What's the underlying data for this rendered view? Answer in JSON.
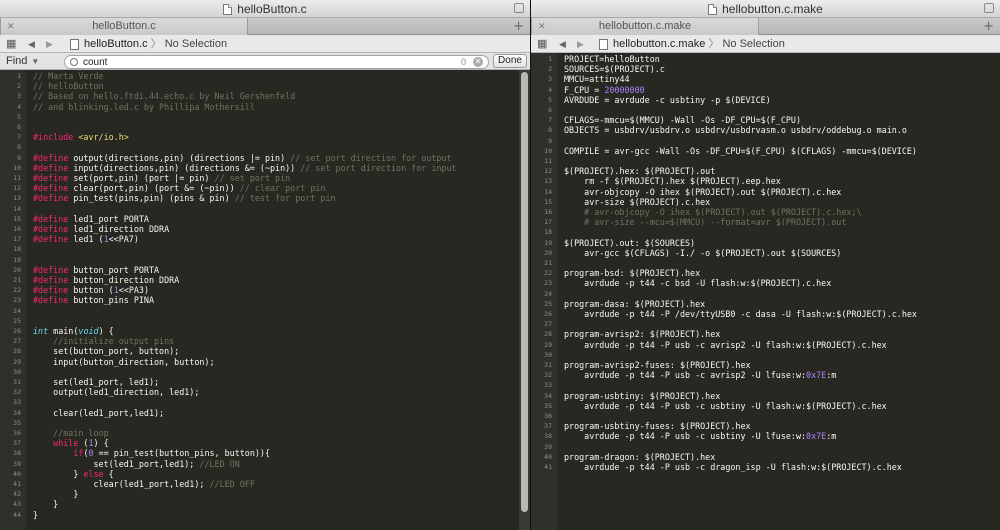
{
  "left": {
    "window_title": "helloButton.c",
    "tab_label": "helloButton.c",
    "jump_file": "helloButton.c",
    "jump_selection": "No Selection",
    "find": {
      "label": "Find",
      "value": "count",
      "match_count": "0",
      "done_label": "Done"
    },
    "lines": [
      "// Marta Verde",
      "// helloButton",
      "// Based on hello.ftdi.44.echo.c by Neil Gershenfeld",
      "// and blinking.led.c by Phillipa Mothersill",
      "",
      "",
      "#include <avr/io.h>",
      "",
      "#define output(directions,pin) (directions |= pin) // set port direction for output",
      "#define input(directions,pin) (directions &= (~pin)) // set port direction for input",
      "#define set(port,pin) (port |= pin) // set port pin",
      "#define clear(port,pin) (port &= (~pin)) // clear port pin",
      "#define pin_test(pins,pin) (pins & pin) // test for port pin",
      "",
      "#define led1_port PORTA",
      "#define led1_direction DDRA",
      "#define led1 (1<<PA7)",
      "",
      "",
      "#define button_port PORTA",
      "#define button_direction DDRA",
      "#define button (1<<PA3)",
      "#define button_pins PINA",
      "",
      "",
      "int main(void) {",
      "    //initialize output pins",
      "    set(button_port, button);",
      "    input(button_direction, button);",
      "",
      "    set(led1_port, led1);",
      "    output(led1_direction, led1);",
      "",
      "    clear(led1_port,led1);",
      "",
      "    //main loop",
      "    while (1) {",
      "        if(0 == pin_test(button_pins, button)){",
      "            set(led1_port,led1); //LED ON",
      "        } else {",
      "            clear(led1_port,led1); //LED OFF",
      "        }",
      "    }",
      "}"
    ]
  },
  "right": {
    "window_title": "hellobutton.c.make",
    "tab_label": "hellobutton.c.make",
    "jump_file": "hellobutton.c.make",
    "jump_selection": "No Selection",
    "lines": [
      "PROJECT=helloButton",
      "SOURCES=$(PROJECT).c",
      "MMCU=attiny44",
      "F_CPU = 20000000",
      "AVRDUDE = avrdude -c usbtiny -p $(DEVICE)",
      "",
      "CFLAGS=-mmcu=$(MMCU) -Wall -Os -DF_CPU=$(F_CPU)",
      "OBJECTS = usbdrv/usbdrv.o usbdrv/usbdrvasm.o usbdrv/oddebug.o main.o",
      "",
      "COMPILE = avr-gcc -Wall -Os -DF_CPU=$(F_CPU) $(CFLAGS) -mmcu=$(DEVICE)",
      "",
      "$(PROJECT).hex: $(PROJECT).out",
      "    rm -f $(PROJECT).hex $(PROJECT).eep.hex",
      "    avr-objcopy -O ihex $(PROJECT).out $(PROJECT).c.hex",
      "    avr-size $(PROJECT).c.hex",
      "    # avr-objcopy -O ihex $(PROJECT).out $(PROJECT).c.hex;\\",
      "    # avr-size --mcu=$(MMCU) --format=avr $(PROJECT).out",
      "",
      "$(PROJECT).out: $(SOURCES)",
      "    avr-gcc $(CFLAGS) -I./ -o $(PROJECT).out $(SOURCES)",
      "",
      "program-bsd: $(PROJECT).hex",
      "    avrdude -p t44 -c bsd -U flash:w:$(PROJECT).c.hex",
      "",
      "program-dasa: $(PROJECT).hex",
      "    avrdude -p t44 -P /dev/ttyUSB0 -c dasa -U flash:w:$(PROJECT).c.hex",
      "",
      "program-avrisp2: $(PROJECT).hex",
      "    avrdude -p t44 -P usb -c avrisp2 -U flash:w:$(PROJECT).c.hex",
      "",
      "program-avrisp2-fuses: $(PROJECT).hex",
      "    avrdude -p t44 -P usb -c avrisp2 -U lfuse:w:0x7E:m",
      "",
      "program-usbtiny: $(PROJECT).hex",
      "    avrdude -p t44 -P usb -c usbtiny -U flash:w:$(PROJECT).c.hex",
      "",
      "program-usbtiny-fuses: $(PROJECT).hex",
      "    avrdude -p t44 -P usb -c usbtiny -U lfuse:w:0x7E:m",
      "",
      "program-dragon: $(PROJECT).hex",
      "    avrdude -p t44 -P usb -c dragon_isp -U flash:w:$(PROJECT).c.hex"
    ]
  },
  "icons": {
    "grid": "grid-icon",
    "back": "back-arrow-icon",
    "forward": "forward-arrow-icon",
    "file": "file-icon",
    "search": "search-icon",
    "close": "close-icon",
    "add": "plus-icon"
  },
  "colors": {
    "background": "#272822",
    "comment": "#75715e",
    "keyword": "#f92672",
    "number": "#ae81ff",
    "string": "#e6db74",
    "text": "#f8f8f2"
  }
}
